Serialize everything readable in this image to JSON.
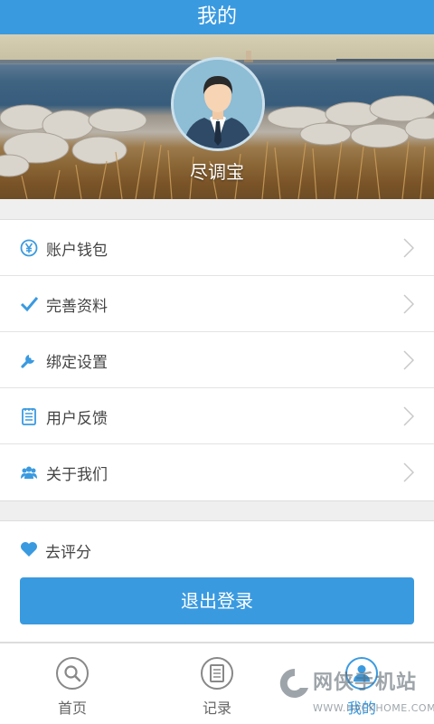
{
  "header": {
    "title": "我的"
  },
  "profile": {
    "username": "尽调宝"
  },
  "menu": {
    "items": [
      {
        "label": "账户钱包",
        "icon": "yen-circle-icon"
      },
      {
        "label": "完善资料",
        "icon": "checkmark-icon"
      },
      {
        "label": "绑定设置",
        "icon": "wrench-icon"
      },
      {
        "label": "用户反馈",
        "icon": "notepad-icon"
      },
      {
        "label": "关于我们",
        "icon": "people-icon"
      }
    ]
  },
  "rating": {
    "label": "去评分",
    "icon": "heart-icon"
  },
  "logout": {
    "label": "退出登录"
  },
  "tabbar": {
    "tabs": [
      {
        "label": "首页",
        "icon": "search-icon",
        "active": false
      },
      {
        "label": "记录",
        "icon": "document-icon",
        "active": false
      },
      {
        "label": "我的",
        "icon": "user-icon",
        "active": true
      }
    ]
  },
  "watermark": {
    "text": "网侠手机站",
    "sub": "WWW.HACKHOME.COM"
  },
  "colors": {
    "accent": "#3a9ae0",
    "text": "#444444",
    "background": "#efefef"
  }
}
